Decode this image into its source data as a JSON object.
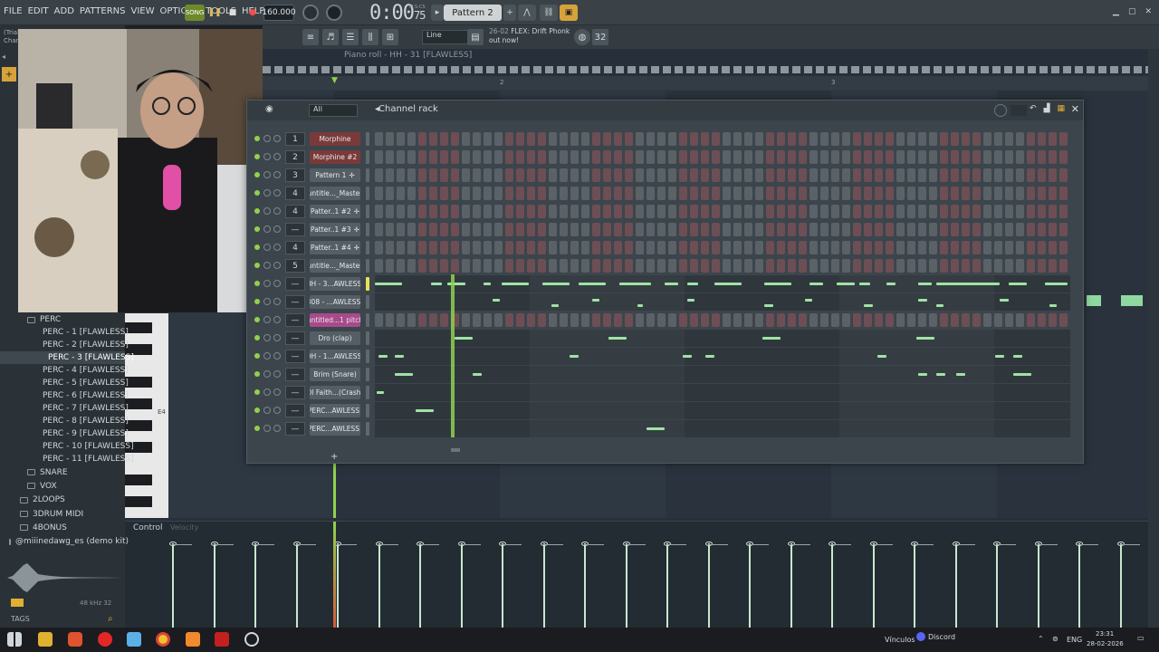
{
  "menu": [
    "FILE",
    "EDIT",
    "ADD",
    "PATTERNS",
    "VIEW",
    "OPTIONS",
    "TOOLS",
    "HELP"
  ],
  "transport": {
    "mode": "SONG",
    "tempo": "160.000",
    "time_main": "0:00",
    "time_sub": "75",
    "time_units": "M:S:CS",
    "pattern": "Pattern 2"
  },
  "toolbar2": {
    "snap": "Line",
    "news_date": "26-02",
    "news_text": "FLEX: Drift Phonk",
    "news_text2": "out now!"
  },
  "browser": {
    "trial": "(Trial",
    "trial2": "Char",
    "items": [
      {
        "label": "PERC",
        "type": "folder",
        "indent": 30
      },
      {
        "label": "PERC - 1 [FLAWLESS]",
        "type": "file",
        "indent": 42
      },
      {
        "label": "PERC - 2 [FLAWLESS]",
        "type": "file",
        "indent": 42
      },
      {
        "label": "PERC - 3 [FLAWLESS]",
        "type": "file",
        "indent": 48,
        "selected": true
      },
      {
        "label": "PERC - 4 [FLAWLESS]",
        "type": "file",
        "indent": 42
      },
      {
        "label": "PERC - 5 [FLAWLESS]",
        "type": "file",
        "indent": 42
      },
      {
        "label": "PERC - 6 [FLAWLESS]",
        "type": "file",
        "indent": 42
      },
      {
        "label": "PERC - 7 [FLAWLESS]",
        "type": "file",
        "indent": 42
      },
      {
        "label": "PERC - 8 [FLAWLESS]",
        "type": "file",
        "indent": 42
      },
      {
        "label": "PERC - 9 [FLAWLESS]",
        "type": "file",
        "indent": 42
      },
      {
        "label": "PERC - 10 [FLAWLESS]",
        "type": "file",
        "indent": 42
      },
      {
        "label": "PERC - 11 [FLAWLESS]",
        "type": "file",
        "indent": 42
      },
      {
        "label": "SNARE",
        "type": "folder",
        "indent": 30,
        "gap": 1
      },
      {
        "label": "VOX",
        "type": "folder",
        "indent": 30,
        "gap": 1
      },
      {
        "label": "2LOOPS",
        "type": "folder",
        "indent": 22,
        "gap": 1
      },
      {
        "label": "3DRUM MIDI",
        "type": "folder",
        "indent": 22,
        "gap": 1
      },
      {
        "label": "4BONUS",
        "type": "folder",
        "indent": 22,
        "gap": 1
      },
      {
        "label": "@miiinedawg_es (demo kit)",
        "type": "folder",
        "indent": 10,
        "gap": 1
      }
    ],
    "samplerate": "48 kHz 32",
    "tags": "TAGS"
  },
  "pianoroll": {
    "title": "Piano roll - HH - 31 [FLAWLESS]",
    "bars": [
      "2",
      "3"
    ],
    "key_label": "E4",
    "control": "Control",
    "velocity": "Velocity"
  },
  "rack": {
    "title": "Channel rack",
    "filter": "All",
    "channels": [
      {
        "num": "1",
        "name": "Morphine",
        "style": "red",
        "kind": "steps"
      },
      {
        "num": "2",
        "name": "Morphine #2",
        "style": "red",
        "kind": "steps"
      },
      {
        "num": "3",
        "name": "Pattern 1",
        "style": "gray",
        "kind": "steps",
        "plus": true
      },
      {
        "num": "4",
        "name": "untitle..._Master",
        "style": "gray",
        "kind": "steps"
      },
      {
        "num": "4",
        "name": "Patter..1 #2",
        "style": "gray",
        "kind": "steps",
        "plus": true
      },
      {
        "num": "—",
        "name": "Patter..1 #3",
        "style": "gray",
        "kind": "steps",
        "plus": true
      },
      {
        "num": "4",
        "name": "Patter..1 #4",
        "style": "gray",
        "kind": "steps",
        "plus": true
      },
      {
        "num": "5",
        "name": "untitle..._Master",
        "style": "gray",
        "kind": "steps"
      },
      {
        "num": "—",
        "name": "HH - 3...AWLESS]",
        "style": "gray",
        "kind": "roll",
        "selected": true
      },
      {
        "num": "—",
        "name": "808 - ...AWLESS]",
        "style": "gray",
        "kind": "roll"
      },
      {
        "num": "—",
        "name": "untitled...1 pitch",
        "style": "pink",
        "kind": "steps"
      },
      {
        "num": "—",
        "name": "Dro (clap)",
        "style": "gray",
        "kind": "roll"
      },
      {
        "num": "—",
        "name": "OH - 1...AWLESS]",
        "style": "gray",
        "kind": "roll"
      },
      {
        "num": "—",
        "name": "Brim (Snare)",
        "style": "gray",
        "kind": "roll"
      },
      {
        "num": "—",
        "name": "Ol Faith...(Crash)",
        "style": "gray",
        "kind": "roll"
      },
      {
        "num": "—",
        "name": "PERC...AWLESS]",
        "style": "gray",
        "kind": "roll"
      },
      {
        "num": "—",
        "name": "PERC...AWLESS]",
        "style": "gray",
        "kind": "roll"
      }
    ]
  },
  "taskbar": {
    "vinculos": "Vínculos",
    "discord": "Discord",
    "lang": "ENG",
    "time": "23:31",
    "date": "28-02-2026"
  },
  "colors": {
    "accent_green": "#8fd14f",
    "note": "#9fe3a4",
    "rec": "#ff4a4a"
  }
}
